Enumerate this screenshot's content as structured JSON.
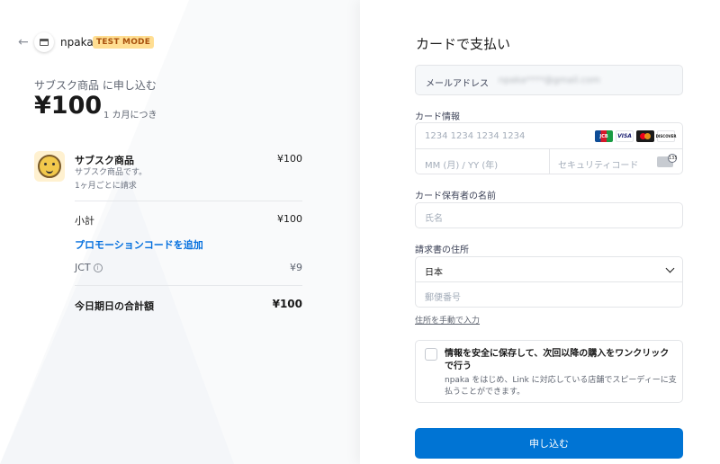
{
  "header": {
    "back_icon": "arrow-left-icon",
    "store_name": "npaka",
    "test_mode_badge": "TEST MODE"
  },
  "summary": {
    "subtitle": "サブスク商品 に申し込む",
    "price": "¥100",
    "period": "1 カ月につき"
  },
  "line_item": {
    "name": "サブスク商品",
    "description": "サブスク商品です。",
    "billing": "1ヶ月ごとに請求",
    "price": "¥100"
  },
  "totals": {
    "subtotal_label": "小計",
    "subtotal_value": "¥100",
    "promo_link": "プロモーションコードを追加",
    "tax_label": "JCT",
    "tax_value": "¥9",
    "total_label": "今日期日の合計額",
    "total_value": "¥100"
  },
  "payment": {
    "title": "カードで支払い",
    "email_label": "メールアドレス",
    "email_value": "npaka****@gmail.com",
    "card_label": "カード情報",
    "card_number_placeholder": "1234 1234 1234 1234",
    "expiry_placeholder": "MM (月) / YY (年)",
    "cvc_placeholder": "セキュリティコード",
    "brands": [
      "JCB",
      "VISA",
      "",
      "DISCOVER"
    ],
    "cardholder_label": "カード保有者の名前",
    "cardholder_placeholder": "氏名",
    "address_label": "請求書の住所",
    "country_value": "日本",
    "postal_placeholder": "郵便番号",
    "manual_address_link": "住所を手動で入力",
    "save_title": "情報を安全に保存して、次回以降の購入をワンクリックで行う",
    "save_desc": "npaka をはじめ、Link に対応している店舗でスピーディーに支払うことができます。",
    "submit_label": "申し込む"
  },
  "colors": {
    "accent": "#0074d4",
    "promo_link": "#0570de",
    "badge_bg": "#ffde92",
    "badge_text": "#a8500d"
  }
}
